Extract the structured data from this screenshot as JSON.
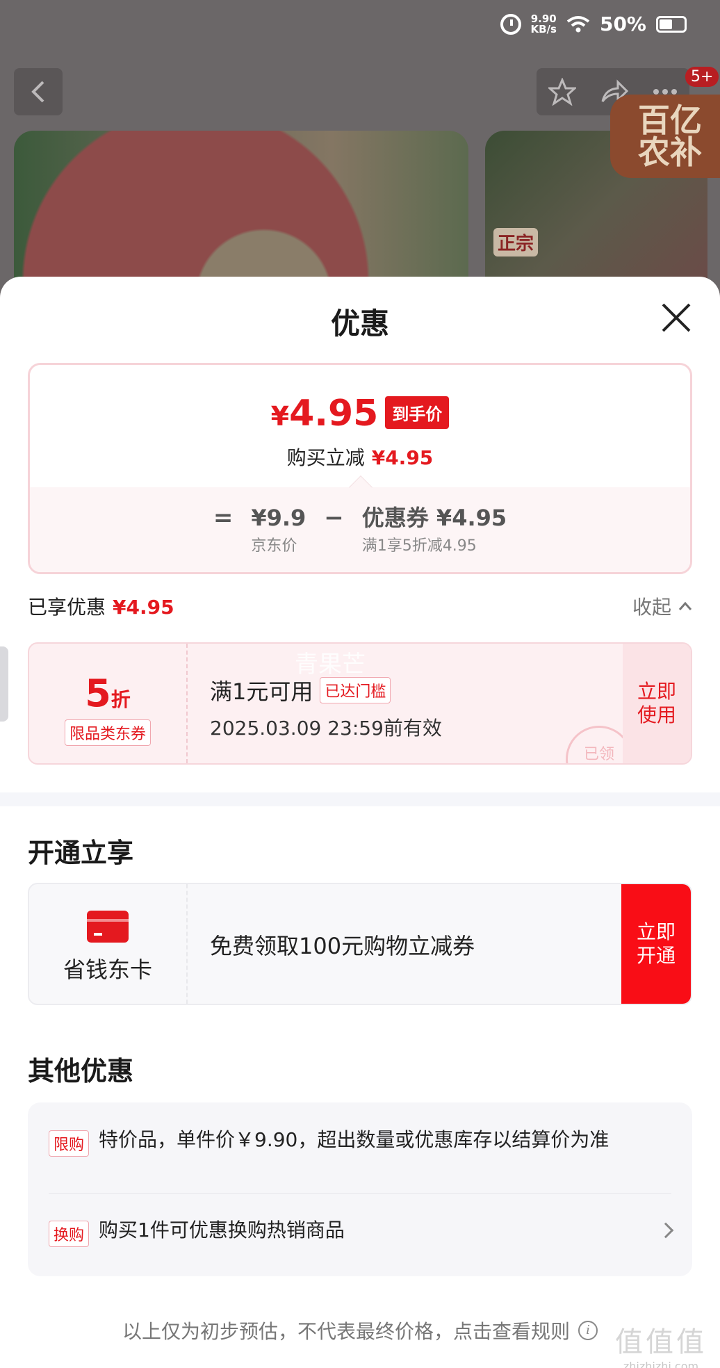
{
  "status_bar": {
    "net_speed_value": "9.90",
    "net_speed_unit": "KB/s",
    "battery": "50%"
  },
  "background_page": {
    "badge_count": "5+",
    "hero_tag": "正宗",
    "promo_sticker_line1": "百亿",
    "promo_sticker_line2": "农补"
  },
  "sheet": {
    "title": "优惠",
    "price_card": {
      "final_price_symbol": "¥",
      "final_price": "4.95",
      "final_tag": "到手价",
      "direct_label": "购买立减",
      "direct_amount": "¥4.95",
      "equals": "=",
      "jd_price": "¥9.9",
      "jd_price_label": "京东价",
      "minus": "−",
      "coupon_label": "优惠券 ¥4.95",
      "coupon_rule": "满1享5折减4.95"
    },
    "enjoyed": {
      "label": "已享优惠",
      "amount": "¥4.95",
      "collapse_label": "收起"
    },
    "coupon": {
      "discount_num": "5",
      "discount_unit": "折",
      "type": "限品类东券",
      "condition": "满1元可用",
      "badge": "已达门槛",
      "validity": "2025.03.09 23:59前有效",
      "action_line1": "立即",
      "action_line2": "使用",
      "stamp": "已领",
      "watermark": "青果芒"
    },
    "open_section": {
      "title": "开通立享",
      "card_name": "省钱东卡",
      "description": "免费领取100元购物立减券",
      "action_line1": "立即",
      "action_line2": "开通"
    },
    "other_section": {
      "title": "其他优惠",
      "items": [
        {
          "tag": "限购",
          "text": "特价品，单件价￥9.90，超出数量或优惠库存以结算价为准"
        },
        {
          "tag": "换购",
          "text": "购买1件可优惠换购热销商品"
        }
      ]
    },
    "footnote": "以上仅为初步预估，不代表最终价格，点击查看规则",
    "watermark": {
      "big": "值值值",
      "small": "zhizhizhi.com"
    }
  },
  "colors": {
    "accent": "#e4191f",
    "action_red": "#f90d16",
    "coupon_bg": "#fdf0f2"
  },
  "icons": [
    "alarm-icon",
    "wifi-icon",
    "battery-icon",
    "back-icon",
    "star-icon",
    "share-icon",
    "more-icon",
    "close-icon",
    "chevron-up-icon",
    "card-icon",
    "chevron-right-icon",
    "info-icon"
  ]
}
